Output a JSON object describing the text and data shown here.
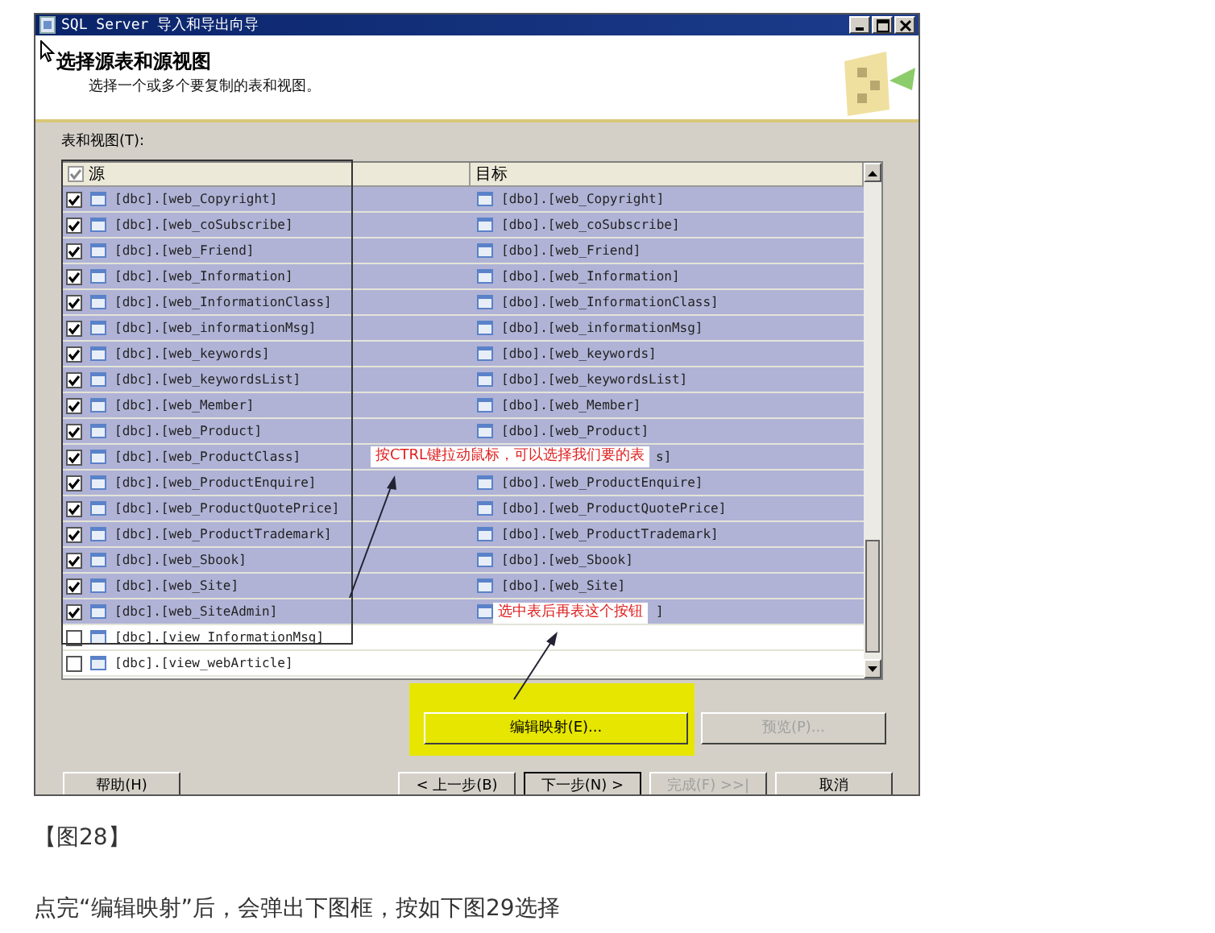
{
  "window": {
    "title": "SQL Server 导入和导出向导"
  },
  "header": {
    "title": "选择源表和源视图",
    "subtitle": "选择一个或多个要复制的表和视图。"
  },
  "table": {
    "label": "表和视图(T):",
    "select_all_checked": true,
    "columns": [
      "源",
      "目标"
    ],
    "rows": [
      {
        "source": "[dbc].[web_Copyright]",
        "target": "[dbo].[web_Copyright]",
        "target_icon": true,
        "checked": true,
        "selected": true,
        "covered": false
      },
      {
        "source": "[dbc].[web_coSubscribe]",
        "target": "[dbo].[web_coSubscribe]",
        "target_icon": true,
        "checked": true,
        "selected": true,
        "covered": false
      },
      {
        "source": "[dbc].[web_Friend]",
        "target": "[dbo].[web_Friend]",
        "target_icon": true,
        "checked": true,
        "selected": true,
        "covered": false
      },
      {
        "source": "[dbc].[web_Information]",
        "target": "[dbo].[web_Information]",
        "target_icon": true,
        "checked": true,
        "selected": true,
        "covered": false
      },
      {
        "source": "[dbc].[web_InformationClass]",
        "target": "[dbo].[web_InformationClass]",
        "target_icon": true,
        "checked": true,
        "selected": true,
        "covered": false
      },
      {
        "source": "[dbc].[web_informationMsg]",
        "target": "[dbo].[web_informationMsg]",
        "target_icon": true,
        "checked": true,
        "selected": true,
        "covered": false
      },
      {
        "source": "[dbc].[web_keywords]",
        "target": "[dbo].[web_keywords]",
        "target_icon": true,
        "checked": true,
        "selected": true,
        "covered": false
      },
      {
        "source": "[dbc].[web_keywordsList]",
        "target": "[dbo].[web_keywordsList]",
        "target_icon": true,
        "checked": true,
        "selected": true,
        "covered": false
      },
      {
        "source": "[dbc].[web_Member]",
        "target": "[dbo].[web_Member]",
        "target_icon": true,
        "checked": true,
        "selected": true,
        "covered": false
      },
      {
        "source": "[dbc].[web_Product]",
        "target": "[dbo].[web_Product]",
        "target_icon": true,
        "checked": true,
        "selected": true,
        "covered": false
      },
      {
        "source": "[dbc].[web_ProductClass]",
        "target": "s]",
        "target_icon": false,
        "checked": true,
        "selected": true,
        "covered": true
      },
      {
        "source": "[dbc].[web_ProductEnquire]",
        "target": "[dbo].[web_ProductEnquire]",
        "target_icon": true,
        "checked": true,
        "selected": true,
        "covered": false
      },
      {
        "source": "[dbc].[web_ProductQuotePrice]",
        "target": "[dbo].[web_ProductQuotePrice]",
        "target_icon": true,
        "checked": true,
        "selected": true,
        "covered": false
      },
      {
        "source": "[dbc].[web_ProductTrademark]",
        "target": "[dbo].[web_ProductTrademark]",
        "target_icon": true,
        "checked": true,
        "selected": true,
        "covered": false
      },
      {
        "source": "[dbc].[web_Sbook]",
        "target": "[dbo].[web_Sbook]",
        "target_icon": true,
        "checked": true,
        "selected": true,
        "covered": false
      },
      {
        "source": "[dbc].[web_Site]",
        "target": "[dbo].[web_Site]",
        "target_icon": true,
        "checked": true,
        "selected": true,
        "covered": false
      },
      {
        "source": "[dbc].[web_SiteAdmin]",
        "target": "]",
        "target_icon": true,
        "checked": true,
        "selected": true,
        "covered": true
      },
      {
        "source": "[dbc].[view_InformationMsg]",
        "checked": false,
        "selected": false
      },
      {
        "source": "[dbc].[view_webArticle]",
        "checked": false,
        "selected": false
      }
    ]
  },
  "actions": [
    {
      "label": "编辑映射(E)...",
      "disabled": false,
      "highlighted": true
    },
    {
      "label": "预览(P)...",
      "disabled": true,
      "highlighted": false
    }
  ],
  "nav_buttons": [
    {
      "label": "帮助(H)",
      "disabled": false
    },
    {
      "label": "< 上一步(B)",
      "disabled": false
    },
    {
      "label": "下一步(N) >",
      "disabled": false
    },
    {
      "label": "完成(F) >>|",
      "disabled": true
    },
    {
      "label": "取消",
      "disabled": false
    }
  ],
  "annotations": [
    "按CTRL键拉动鼠标，可以选择我们要的表",
    "选中表后再表这个按钮"
  ],
  "caption": "【图28】",
  "paragraph": "点完“编辑映射”后，会弹出下图框，按如下图29选择"
}
